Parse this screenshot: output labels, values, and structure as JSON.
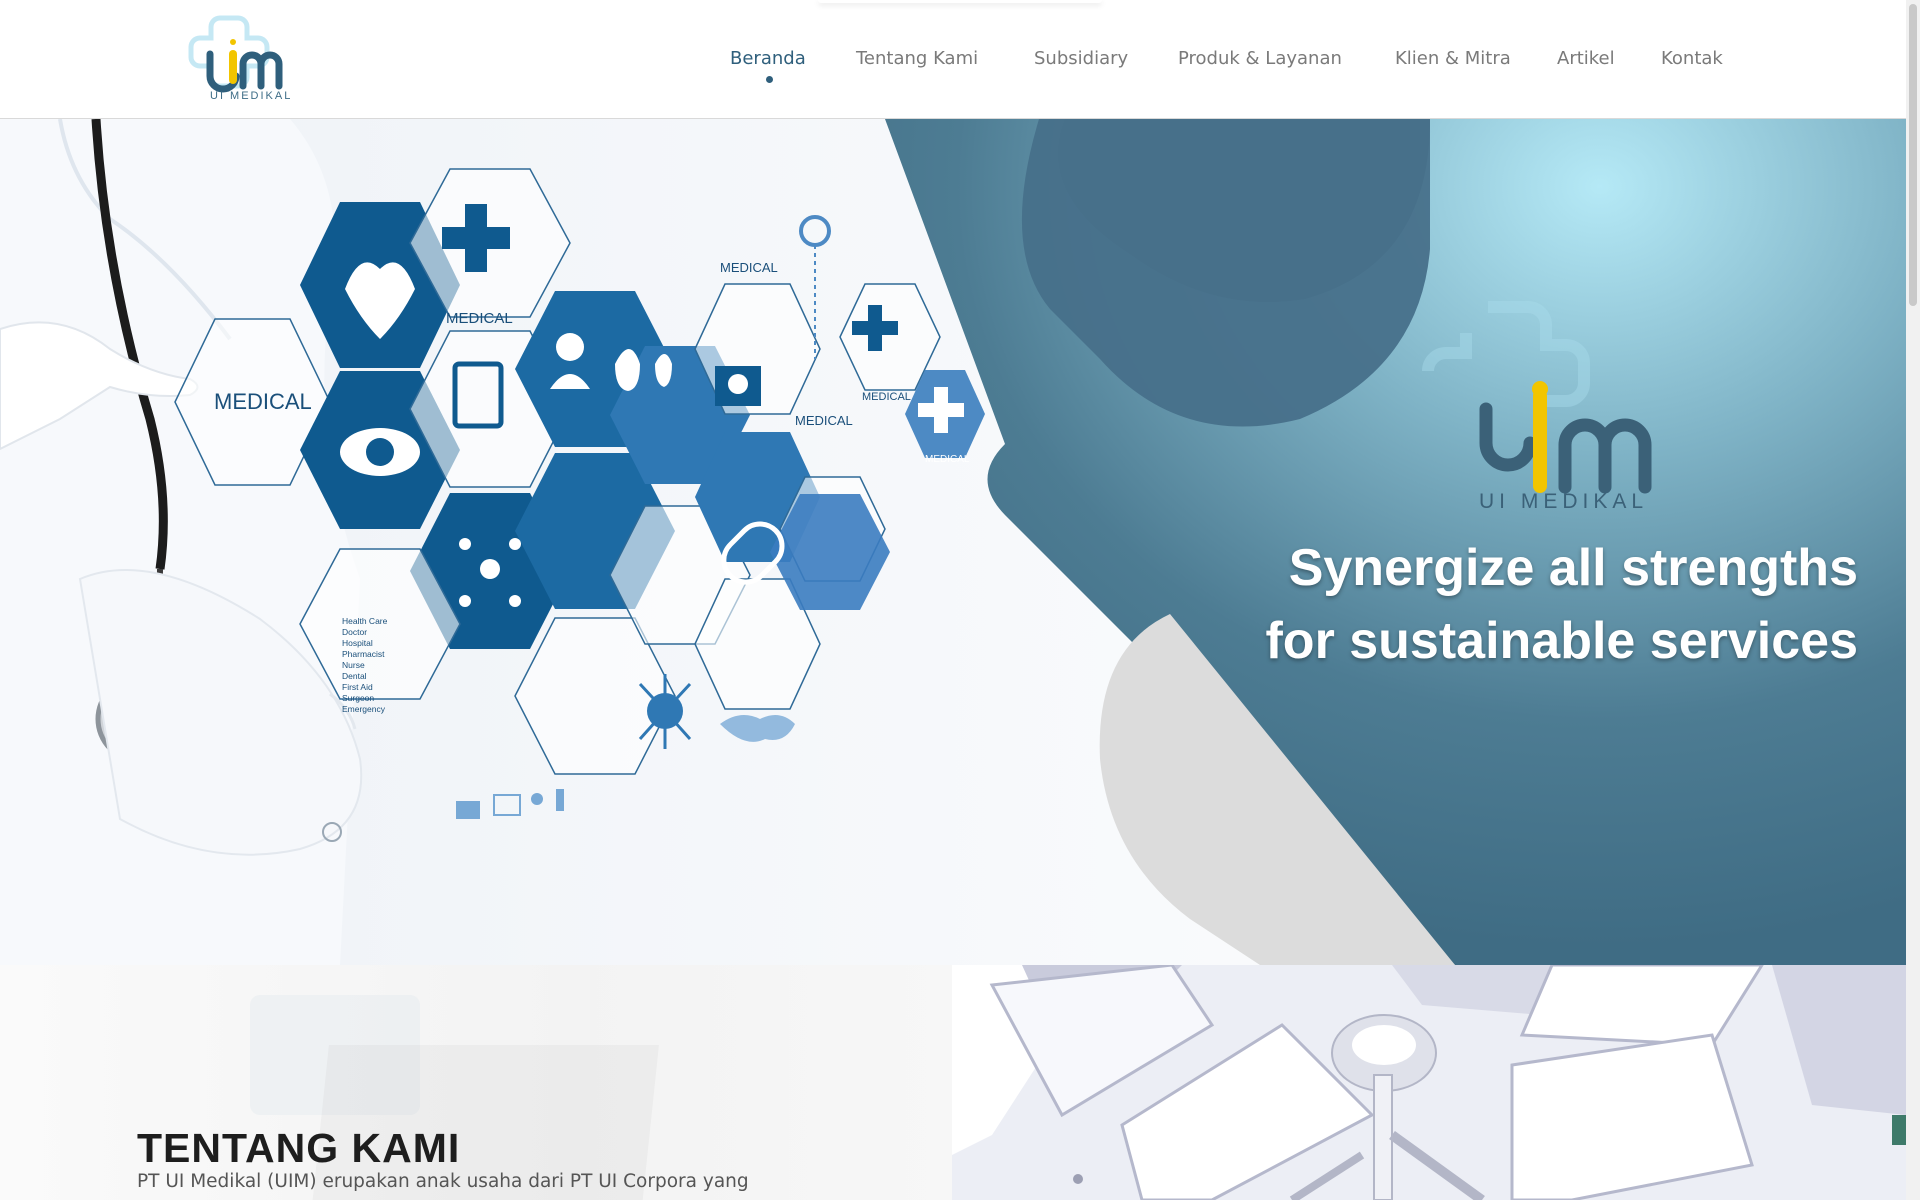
{
  "brand": {
    "name": "UI MEDIKAL",
    "colors": {
      "primary": "#2f5f7c",
      "accent": "#f2c500",
      "light_blue": "#9fd6ea"
    }
  },
  "nav": {
    "items": [
      {
        "label": "Beranda",
        "active": true
      },
      {
        "label": "Tentang Kami",
        "active": false
      },
      {
        "label": "Subsidiary",
        "active": false
      },
      {
        "label": "Produk & Layanan",
        "active": false
      },
      {
        "label": "Klien & Mitra",
        "active": false
      },
      {
        "label": "Artikel",
        "active": false
      },
      {
        "label": "Kontak",
        "active": false
      }
    ]
  },
  "hero": {
    "tagline_line1": "Synergize all strengths",
    "tagline_line2": "for sustainable services",
    "hex_labels": {
      "medical_left": "MEDICAL",
      "medical_top": "MEDICAL",
      "medical_right_1": "MEDICAL",
      "medical_right_2": "MEDICAL",
      "medical_right_3": "MEDICAL",
      "medical_bag": "MEDICAL"
    },
    "list_text": [
      "Health Care",
      "Doctor",
      "Hospital",
      "Pharmacist",
      "Nurse",
      "Dental",
      "First Aid",
      "Surgeon",
      "Emergency"
    ]
  },
  "about": {
    "title": "TENTANG KAMI",
    "text": "PT UI Medikal (UIM) erupakan anak usaha dari PT UI Corpora yang"
  }
}
